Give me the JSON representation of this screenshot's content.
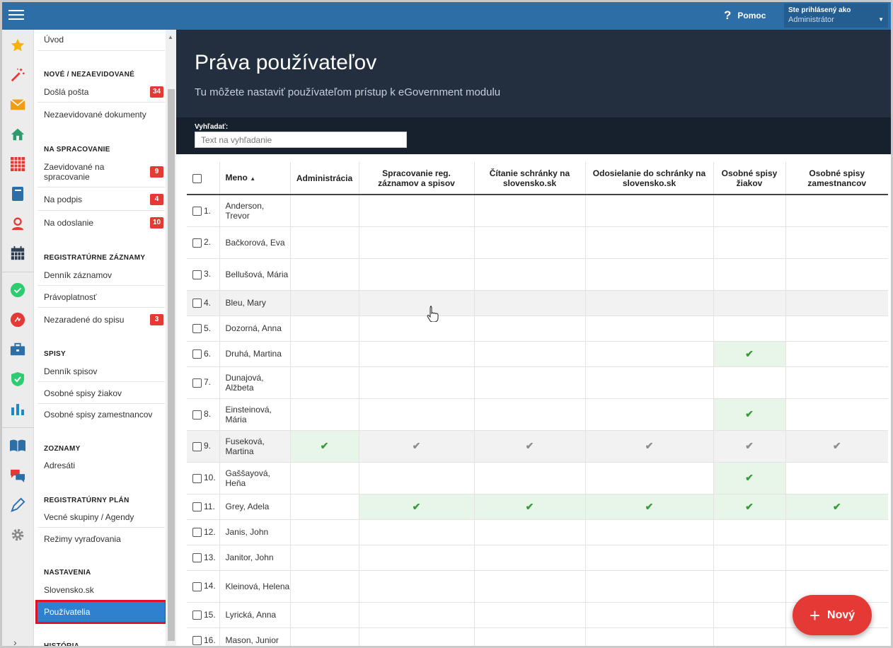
{
  "topbar": {
    "help_label": "Pomoc",
    "user_line1": "Ste prihlásený ako",
    "user_line2": "Administrátor"
  },
  "rail": [
    {
      "icon": "star-icon",
      "color": "#f5b400"
    },
    {
      "icon": "magic-wand-icon",
      "color": "#e53935"
    },
    {
      "icon": "envelope-icon",
      "color": "#f39c12"
    },
    {
      "icon": "home-icon",
      "color": "#2e9b6f"
    },
    {
      "icon": "grid-icon",
      "color": "#e53935"
    },
    {
      "icon": "notebook-icon",
      "color": "#2d6ea6"
    },
    {
      "icon": "user-icon",
      "color": "#e53935"
    },
    {
      "icon": "calendar-icon",
      "color": "#2d3e50"
    },
    {
      "icon": "check-circle-icon",
      "color": "#2ecc71"
    },
    {
      "icon": "red-circle-icon",
      "color": "#e53935"
    },
    {
      "icon": "briefcase-icon",
      "color": "#2d6ea6"
    },
    {
      "icon": "shield-check-icon",
      "color": "#2ecc71"
    },
    {
      "icon": "bar-chart-icon",
      "color": "#1e88c7"
    },
    {
      "icon": "open-book-icon",
      "color": "#2d6ea6"
    },
    {
      "icon": "chat-icon",
      "color": "#e53935"
    },
    {
      "icon": "pen-icon",
      "color": "#2d6ea6"
    },
    {
      "icon": "gear-icon",
      "color": "#888888"
    }
  ],
  "menu": {
    "uvod": "Úvod",
    "sec1": "NOVÉ / NEZAEVIDOVANÉ",
    "dosla": "Došlá pošta",
    "dosla_badge": "34",
    "nezaevid": "Nezaevidované dokumenty",
    "sec2": "NA SPRACOVANIE",
    "zaevid": "Zaevidované na spracovanie",
    "zaevid_badge": "9",
    "napodpis": "Na podpis",
    "napodpis_badge": "4",
    "naodoslanie": "Na odoslanie",
    "naodoslanie_badge": "10",
    "sec3": "REGISTRATÚRNE ZÁZNAMY",
    "dennik_zaz": "Denník záznamov",
    "pravoplat": "Právoplatnosť",
    "nezaradene": "Nezaradené do spisu",
    "nezaradene_badge": "3",
    "sec4": "SPISY",
    "dennik_spis": "Denník spisov",
    "osob_ziak": "Osobné spisy žiakov",
    "osob_zam": "Osobné spisy zamestnancov",
    "sec5": "ZOZNAMY",
    "adresati": "Adresáti",
    "sec6": "REGISTRATÚRNY PLÁN",
    "vecne": "Vecné skupiny / Agendy",
    "rezimy": "Režimy vyraďovania",
    "sec7": "NASTAVENIA",
    "slovensko": "Slovensko.sk",
    "pouzivatelia": "Používatelia",
    "sec8": "HISTÓRIA"
  },
  "header": {
    "title": "Práva používateľov",
    "subtitle": "Tu môžete nastaviť používateľom prístup k eGovernment modulu",
    "search_label": "Vyhľadať:",
    "search_placeholder": "Text na vyhľadanie"
  },
  "table": {
    "col_name": "Meno",
    "cols": [
      "Administrácia",
      "Spracovanie reg. záznamov a spisov",
      "Čítanie schránky na slovensko.sk",
      "Odosielanie do schránky na slovensko.sk",
      "Osobné spisy žiakov",
      "Osobné spisy zamestnancov"
    ],
    "rows": [
      {
        "num": "1.",
        "name": "Anderson, Trevor",
        "p": [
          "",
          "",
          "",
          "",
          "",
          ""
        ]
      },
      {
        "num": "2.",
        "name": "Bačkorová, Eva",
        "p": [
          "",
          "",
          "",
          "",
          "",
          ""
        ]
      },
      {
        "num": "3.",
        "name": "Bellušová, Mária",
        "p": [
          "",
          "",
          "",
          "",
          "",
          ""
        ]
      },
      {
        "num": "4.",
        "name": "Bleu, Mary",
        "p": [
          "",
          "",
          "",
          "",
          "",
          ""
        ],
        "hl": true
      },
      {
        "num": "5.",
        "name": "Dozorná, Anna",
        "p": [
          "",
          "",
          "",
          "",
          "",
          ""
        ]
      },
      {
        "num": "6.",
        "name": "Druhá, Martina",
        "p": [
          "",
          "",
          "",
          "",
          "g",
          ""
        ]
      },
      {
        "num": "7.",
        "name": "Dunajová, Alžbeta",
        "p": [
          "",
          "",
          "",
          "",
          "",
          ""
        ]
      },
      {
        "num": "8.",
        "name": "Einsteinová, Mária",
        "p": [
          "",
          "",
          "",
          "",
          "g",
          ""
        ]
      },
      {
        "num": "9.",
        "name": "Fuseková, Martina",
        "p": [
          "g",
          "x",
          "x",
          "x",
          "x",
          "x"
        ],
        "hl": true
      },
      {
        "num": "10.",
        "name": "Gaššayová, Heňa",
        "p": [
          "",
          "",
          "",
          "",
          "g",
          ""
        ]
      },
      {
        "num": "11.",
        "name": "Grey, Adela",
        "p": [
          "",
          "g",
          "g",
          "g",
          "g",
          "g"
        ]
      },
      {
        "num": "12.",
        "name": "Janis, John",
        "p": [
          "",
          "",
          "",
          "",
          "",
          ""
        ]
      },
      {
        "num": "13.",
        "name": "Janitor, John",
        "p": [
          "",
          "",
          "",
          "",
          "",
          ""
        ]
      },
      {
        "num": "14.",
        "name": "Kleinová, Helena",
        "p": [
          "",
          "",
          "",
          "",
          "",
          ""
        ]
      },
      {
        "num": "15.",
        "name": "Lyrická, Anna",
        "p": [
          "",
          "",
          "",
          "",
          "",
          ""
        ]
      },
      {
        "num": "16.",
        "name": "Mason, Junior",
        "p": [
          "",
          "",
          "",
          "",
          "",
          ""
        ]
      }
    ]
  },
  "fab": {
    "label": "Nový"
  },
  "colors": {
    "topbar": "#2d6ea6",
    "header": "#232f3e",
    "badge": "#e53935",
    "active": "#2f80ce",
    "granted": "#3a9c3a",
    "inherited": "#8e8e8e"
  }
}
